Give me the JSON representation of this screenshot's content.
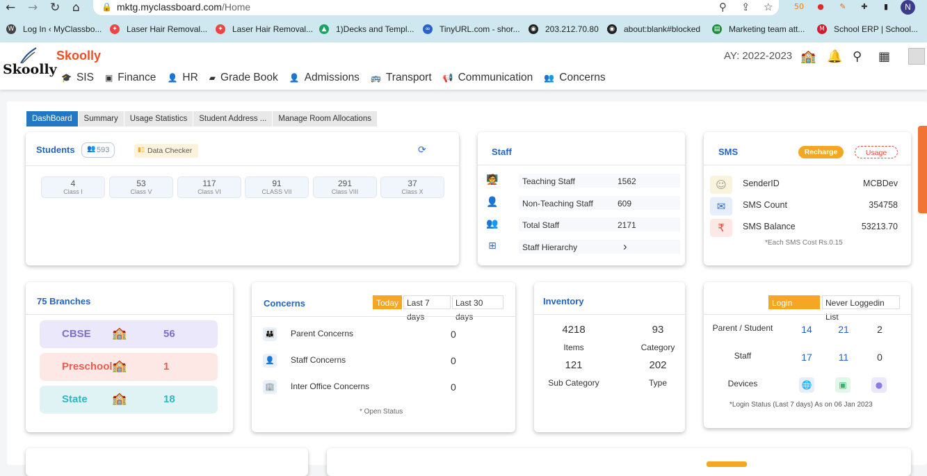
{
  "browser": {
    "url_host": "mktg.myclassboard.com",
    "url_path": "/Home",
    "profile_initial": "N",
    "bookmarks": [
      {
        "label": "Log In ‹ MyClassbo...",
        "icon": "wordpress-icon",
        "color": "#444"
      },
      {
        "label": "Laser Hair Removal...",
        "icon": "bookmark-icon",
        "color": "#e44"
      },
      {
        "label": "Laser Hair Removal...",
        "icon": "bookmark-icon",
        "color": "#e44"
      },
      {
        "label": "1)Decks and Templ...",
        "icon": "drive-icon",
        "color": "#1aa260"
      },
      {
        "label": "TinyURL.com - shor...",
        "icon": "link-icon",
        "color": "#2a62c9"
      },
      {
        "label": "203.212.70.80",
        "icon": "globe-icon",
        "color": "#222"
      },
      {
        "label": "about:blank#blocked",
        "icon": "globe-icon",
        "color": "#222"
      },
      {
        "label": "Marketing team att...",
        "icon": "sheets-icon",
        "color": "#1e8e3e"
      },
      {
        "label": "School ERP | School...",
        "icon": "m-icon",
        "color": "#d7192b"
      }
    ]
  },
  "app": {
    "brand": "Skoolly",
    "logo_text": "Skoolly",
    "academic_year": "AY: 2022-2023",
    "menu": [
      {
        "label": "SIS",
        "icon": "graduation-cap-icon"
      },
      {
        "label": "Finance",
        "icon": "money-icon"
      },
      {
        "label": "HR",
        "icon": "user-icon"
      },
      {
        "label": "Grade Book",
        "icon": "book-icon"
      },
      {
        "label": "Admissions",
        "icon": "user-icon"
      },
      {
        "label": "Transport",
        "icon": "bus-icon"
      },
      {
        "label": "Communication",
        "icon": "megaphone-icon"
      },
      {
        "label": "Concerns",
        "icon": "group-icon"
      }
    ]
  },
  "tabs": [
    "DashBoard",
    "Summary",
    "Usage Statistics",
    "Student Address ...",
    "Manage Room Allocations"
  ],
  "students": {
    "title": "Students",
    "count": "593",
    "data_checker": "Data Checker",
    "classes": [
      {
        "n": "4",
        "label": "Class I"
      },
      {
        "n": "53",
        "label": "Class V"
      },
      {
        "n": "117",
        "label": "Class VI"
      },
      {
        "n": "91",
        "label": "CLASS VII"
      },
      {
        "n": "291",
        "label": "Class VIII"
      },
      {
        "n": "37",
        "label": "Class X"
      }
    ]
  },
  "staff": {
    "title": "Staff",
    "rows": [
      {
        "label": "Teaching Staff",
        "value": "1562"
      },
      {
        "label": "Non-Teaching Staff",
        "value": "609"
      },
      {
        "label": "Total Staff",
        "value": "2171"
      },
      {
        "label": "Staff Hierarchy",
        "value": "›"
      }
    ]
  },
  "sms": {
    "title": "SMS",
    "recharge": "Recharge",
    "usage": "Usage",
    "rows": [
      {
        "label": "SenderID",
        "value": "MCBDev"
      },
      {
        "label": "SMS Count",
        "value": "354758"
      },
      {
        "label": "SMS Balance",
        "value": "53213.70"
      }
    ],
    "note": "*Each SMS Cost Rs.0.15"
  },
  "branches": {
    "title": "75 Branches",
    "items": [
      {
        "name": "CBSE",
        "count": "56",
        "bg": "#ece8fb",
        "color": "#7b6fd6"
      },
      {
        "name": "Preschool",
        "count": "1",
        "bg": "#fde8e6",
        "color": "#ef5b4d"
      },
      {
        "name": "State",
        "count": "18",
        "bg": "#dff2f4",
        "color": "#2bb8c4"
      }
    ]
  },
  "concerns": {
    "title": "Concerns",
    "filters": [
      "Today",
      "Last 7 days",
      "Last 30 days"
    ],
    "rows": [
      {
        "label": "Parent Concerns",
        "value": "0"
      },
      {
        "label": "Staff Concerns",
        "value": "0"
      },
      {
        "label": "Inter Office Concerns",
        "value": "0"
      }
    ],
    "note": "* Open Status"
  },
  "inventory": {
    "title": "Inventory",
    "items": {
      "value": "4218",
      "label": "Items"
    },
    "category": {
      "value": "93",
      "label": "Category"
    },
    "sub_category": {
      "value": "121",
      "label": "Sub Category"
    },
    "type": {
      "value": "202",
      "label": "Type"
    }
  },
  "login": {
    "tabs": [
      "Login Status",
      "Never Loggedin List"
    ],
    "rows": [
      {
        "label": "Parent / Student",
        "values": [
          "14",
          "21",
          "2"
        ]
      },
      {
        "label": "Staff",
        "values": [
          "17",
          "11",
          "0"
        ]
      }
    ],
    "devices_label": "Devices",
    "note": "*Login Status (Last 7 days) As on 06 Jan 2023"
  }
}
